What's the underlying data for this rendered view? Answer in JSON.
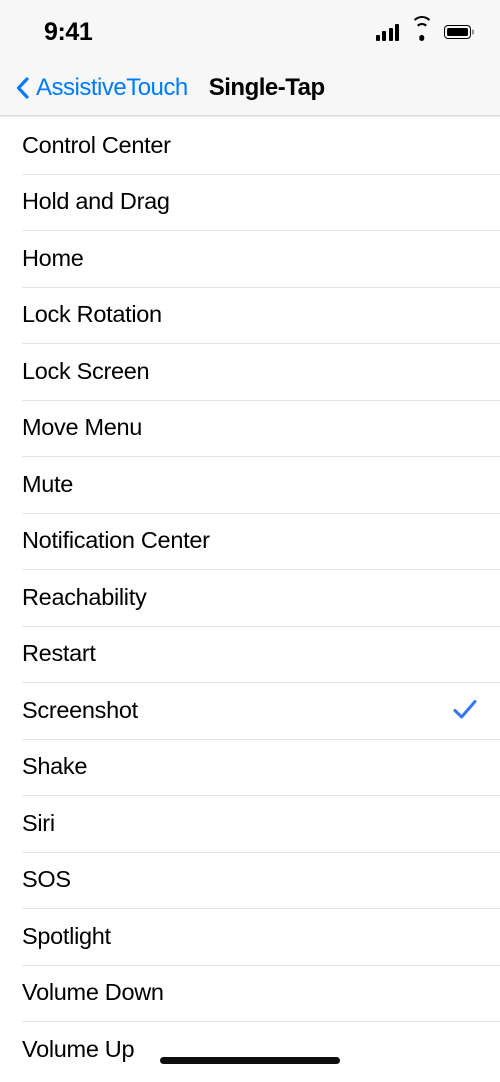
{
  "status_bar": {
    "time": "9:41",
    "cellular_icon": "cellular-signal-icon",
    "wifi_icon": "wifi-icon",
    "battery_icon": "battery-full-icon"
  },
  "nav_bar": {
    "back_icon": "chevron-left-icon",
    "back_label": "AssistiveTouch",
    "title": "Single-Tap"
  },
  "colors": {
    "accent_blue": "#007AFF",
    "checkmark_blue": "#3478F6",
    "separator": "#E4E4E6",
    "bar_background": "#F7F7F7",
    "row_background": "#FFFFFF",
    "label_text": "#000000"
  },
  "list": {
    "checkmark_icon": "checkmark-icon",
    "selected_label": "Screenshot",
    "rows": [
      {
        "label": "Control Center",
        "checked": false
      },
      {
        "label": "Hold and Drag",
        "checked": false
      },
      {
        "label": "Home",
        "checked": false
      },
      {
        "label": "Lock Rotation",
        "checked": false
      },
      {
        "label": "Lock Screen",
        "checked": false
      },
      {
        "label": "Move Menu",
        "checked": false
      },
      {
        "label": "Mute",
        "checked": false
      },
      {
        "label": "Notification Center",
        "checked": false
      },
      {
        "label": "Reachability",
        "checked": false
      },
      {
        "label": "Restart",
        "checked": false
      },
      {
        "label": "Screenshot",
        "checked": true
      },
      {
        "label": "Shake",
        "checked": false
      },
      {
        "label": "Siri",
        "checked": false
      },
      {
        "label": "SOS",
        "checked": false
      },
      {
        "label": "Spotlight",
        "checked": false
      },
      {
        "label": "Volume Down",
        "checked": false
      },
      {
        "label": "Volume Up",
        "checked": false
      }
    ]
  },
  "home_indicator": {
    "name": "home-indicator"
  }
}
